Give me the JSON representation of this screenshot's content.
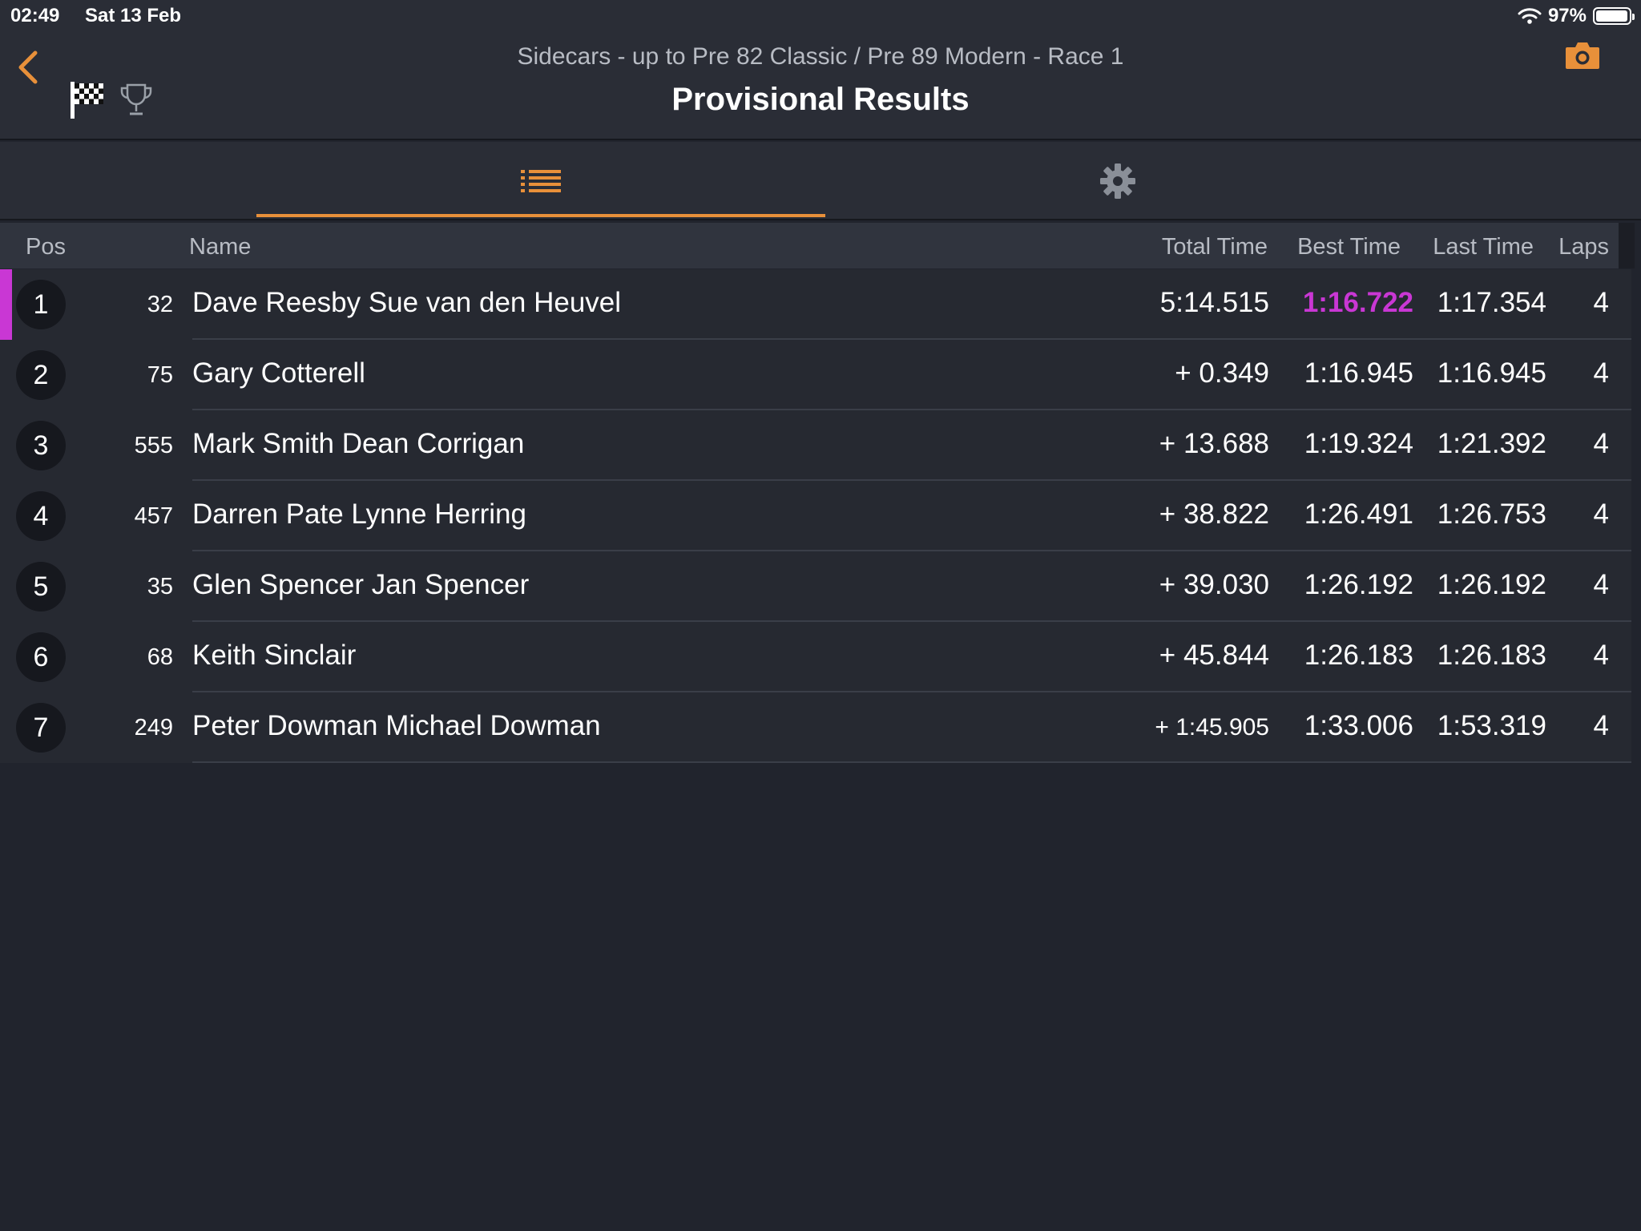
{
  "status": {
    "time": "02:49",
    "date": "Sat 13 Feb",
    "battery": "97%",
    "battery_level": 0.97
  },
  "header": {
    "subtitle": "Sidecars - up to Pre 82 Classic / Pre 89 Modern - Race 1",
    "title": "Provisional Results"
  },
  "tabs": [
    {
      "icon": "list-icon",
      "active": true
    },
    {
      "icon": "gear-icon",
      "active": false
    }
  ],
  "columns": {
    "pos": "Pos",
    "name": "Name",
    "total": "Total Time",
    "best": "Best Time",
    "last": "Last Time",
    "laps": "Laps"
  },
  "colors": {
    "accent": "#e8903a",
    "fastest": "#c937d4"
  },
  "results": [
    {
      "pos": "1",
      "number": "32",
      "name": "Dave  Reesby Sue van den Heuvel",
      "total": "5:14.515",
      "best": "1:16.722",
      "last": "1:17.354",
      "laps": "4"
    },
    {
      "pos": "2",
      "number": "75",
      "name": "Gary Cotterell",
      "total": "+ 0.349",
      "best": "1:16.945",
      "last": "1:16.945",
      "laps": "4"
    },
    {
      "pos": "3",
      "number": "555",
      "name": "Mark Smith Dean Corrigan",
      "total": "+ 13.688",
      "best": "1:19.324",
      "last": "1:21.392",
      "laps": "4"
    },
    {
      "pos": "4",
      "number": "457",
      "name": "Darren Pate Lynne Herring",
      "total": "+ 38.822",
      "best": "1:26.491",
      "last": "1:26.753",
      "laps": "4"
    },
    {
      "pos": "5",
      "number": "35",
      "name": "Glen Spencer Jan Spencer",
      "total": "+ 39.030",
      "best": "1:26.192",
      "last": "1:26.192",
      "laps": "4"
    },
    {
      "pos": "6",
      "number": "68",
      "name": "Keith Sinclair",
      "total": "+ 45.844",
      "best": "1:26.183",
      "last": "1:26.183",
      "laps": "4"
    },
    {
      "pos": "7",
      "number": "249",
      "name": "Peter Dowman Michael Dowman",
      "total": "+ 1:45.905",
      "best": "1:33.006",
      "last": "1:53.319",
      "laps": "4"
    }
  ]
}
